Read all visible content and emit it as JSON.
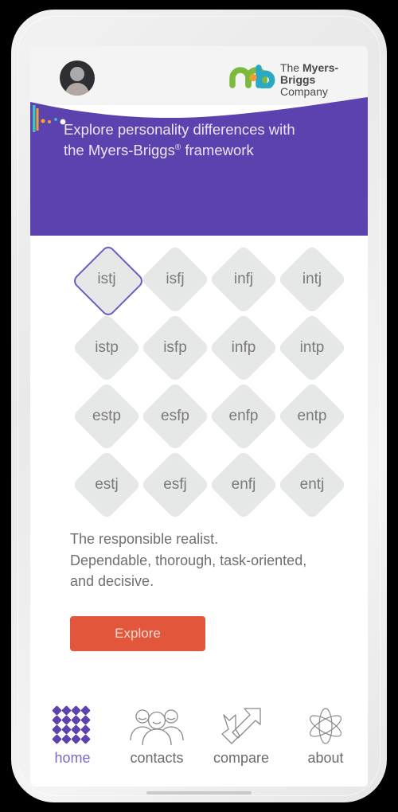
{
  "app": {
    "title": "The Myers-Briggs Company",
    "brand_purple": "#5B42AE",
    "accent_orange": "#E2573C",
    "selected_border": "#6D5CC0"
  },
  "topbar": {
    "avatar_name": "user-avatar",
    "logo": {
      "line1_light": "The ",
      "line1_bold": "Myers-Briggs",
      "line2": "Company",
      "mark_green": "#7DB93F",
      "mark_teal": "#2BA8C4"
    }
  },
  "banner": {
    "heading_line1": "Explore personality differences with",
    "heading_line2_pre": "the Myers-Briggs",
    "heading_registered": "®",
    "heading_line2_post": " framework",
    "background": "#5B42AE",
    "deco": {
      "bar_teal": "#3BC4BE",
      "bar_orange": "#F0A030",
      "dot_orange": "#F0A030",
      "dot_white": "#FFFFFF",
      "dot_teal": "#3BC4BE"
    }
  },
  "grid": {
    "selected": "istj",
    "rows": [
      [
        "istj",
        "isfj",
        "infj",
        "intj"
      ],
      [
        "istp",
        "isfp",
        "infp",
        "intp"
      ],
      [
        "estp",
        "esfp",
        "enfp",
        "entp"
      ],
      [
        "estj",
        "esfj",
        "enfj",
        "entj"
      ]
    ]
  },
  "description": {
    "line1": "The responsible realist.",
    "line2": "Dependable, thorough, task-oriented,",
    "line3": "and decisive."
  },
  "cta": {
    "explore_label": "Explore"
  },
  "nav": {
    "items": [
      {
        "label": "home",
        "icon": "home-diamond-grid-icon",
        "active": true
      },
      {
        "label": "contacts",
        "icon": "people-group-icon",
        "active": false
      },
      {
        "label": "compare",
        "icon": "crossed-arrows-icon",
        "active": false
      },
      {
        "label": "about",
        "icon": "atom-icon",
        "active": false
      }
    ]
  }
}
